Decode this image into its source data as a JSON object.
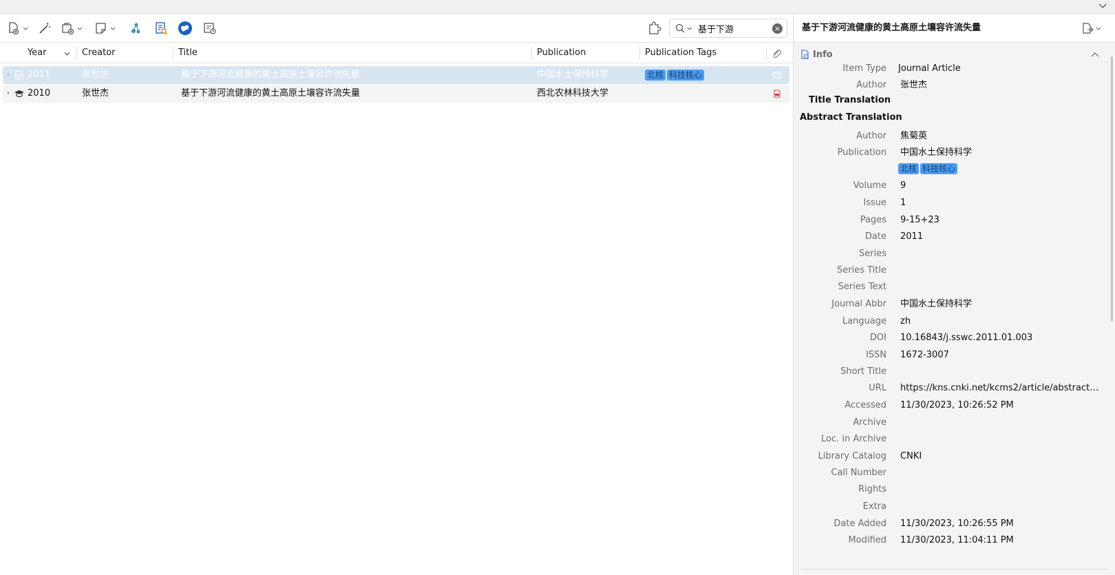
{
  "search": {
    "value": "基于下游"
  },
  "columns": {
    "year": "Year",
    "creator": "Creator",
    "title": "Title",
    "publication": "Publication",
    "pub_tags": "Publication Tags"
  },
  "rows": [
    {
      "year": "2011",
      "creator": "张世杰",
      "title": "基于下游河流健康的黄土高原土壤容许流失量",
      "publication": "中国水土保持科学",
      "tags": [
        "北核",
        "科技核心"
      ],
      "selected": true
    },
    {
      "year": "2010",
      "creator": "张世杰",
      "title": "基于下游河流健康的黄土高原土壤容许流失量",
      "publication": "西北农林科技大学",
      "tags": [],
      "selected": false
    }
  ],
  "item_pane": {
    "title": "基于下游河流健康的黄土高原土壤容许流失量",
    "section": "Info",
    "title_translation": "Title Translation",
    "abstract_translation": "Abstract Translation",
    "fields": {
      "item_type": {
        "label": "Item Type",
        "value": "Journal Article"
      },
      "author1": {
        "label": "Author",
        "value": "张世杰"
      },
      "author2": {
        "label": "Author",
        "value": "焦菊英"
      },
      "publication": {
        "label": "Publication",
        "value": "中国水土保持科学"
      },
      "tags": [
        "北核",
        "科技核心"
      ],
      "volume": {
        "label": "Volume",
        "value": "9"
      },
      "issue": {
        "label": "Issue",
        "value": "1"
      },
      "pages": {
        "label": "Pages",
        "value": "9-15+23"
      },
      "date": {
        "label": "Date",
        "value": "2011"
      },
      "series": {
        "label": "Series",
        "value": ""
      },
      "series_title": {
        "label": "Series Title",
        "value": ""
      },
      "series_text": {
        "label": "Series Text",
        "value": ""
      },
      "journal_abbr": {
        "label": "Journal Abbr",
        "value": "中国水土保持科学"
      },
      "language": {
        "label": "Language",
        "value": "zh"
      },
      "doi": {
        "label": "DOI",
        "value": "10.16843/j.sswc.2011.01.003"
      },
      "issn": {
        "label": "ISSN",
        "value": "1672-3007"
      },
      "short_title": {
        "label": "Short Title",
        "value": ""
      },
      "url": {
        "label": "URL",
        "value": "https://kns.cnki.net/kcms2/article/abstract?v=…"
      },
      "accessed": {
        "label": "Accessed",
        "value": "11/30/2023, 10:26:52 PM"
      },
      "archive": {
        "label": "Archive",
        "value": ""
      },
      "loc_archive": {
        "label": "Loc. in Archive",
        "value": ""
      },
      "library_catalog": {
        "label": "Library Catalog",
        "value": "CNKI"
      },
      "call_number": {
        "label": "Call Number",
        "value": ""
      },
      "rights": {
        "label": "Rights",
        "value": ""
      },
      "extra": {
        "label": "Extra",
        "value": ""
      },
      "date_added": {
        "label": "Date Added",
        "value": "11/30/2023, 10:26:55 PM"
      },
      "modified": {
        "label": "Modified",
        "value": "11/30/2023, 11:04:11 PM"
      }
    }
  }
}
